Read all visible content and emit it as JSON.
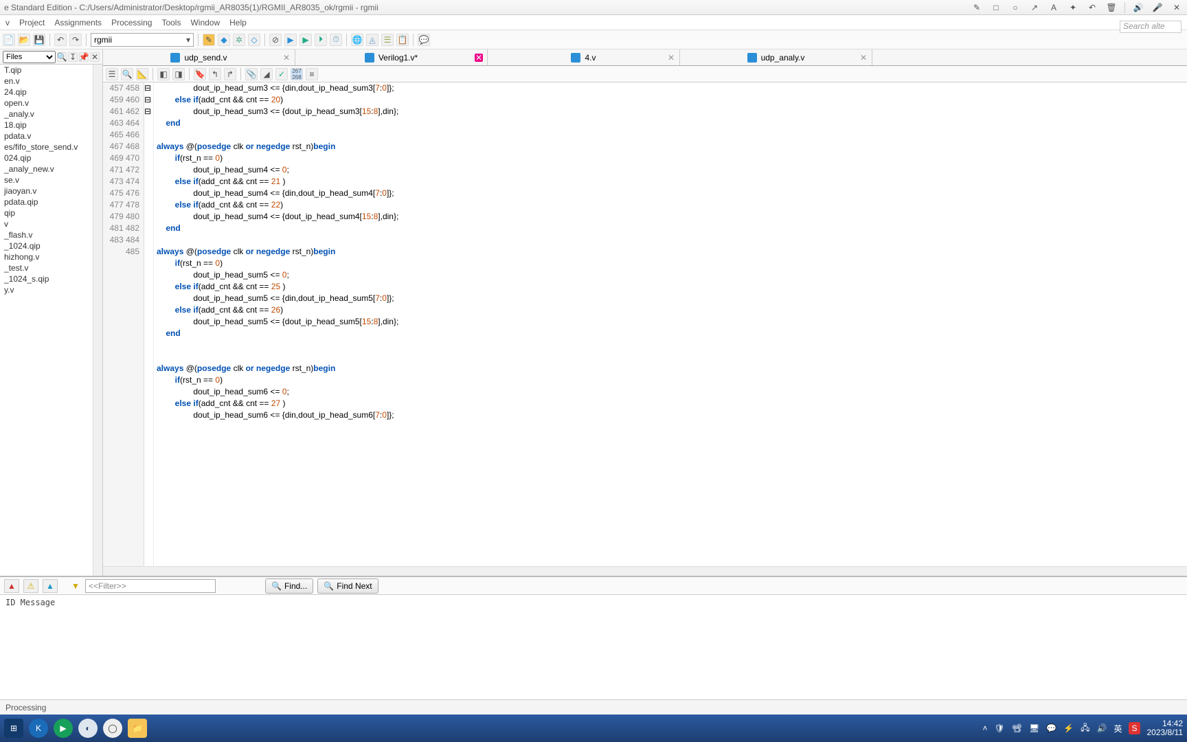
{
  "window": {
    "title": "e Standard Edition - C:/Users/Administrator/Desktop/rgmii_AR8035(1)/RGMII_AR8035_ok/rgmii - rgmii"
  },
  "menus": [
    "v",
    "Project",
    "Assignments",
    "Processing",
    "Tools",
    "Window",
    "Help"
  ],
  "search_placeholder": "Search alte",
  "combo_main": "rgmii",
  "sidebar": {
    "mode": "Files",
    "items": [
      "T.qip",
      "en.v",
      "24.qip",
      "open.v",
      "_analy.v",
      "18.qip",
      "pdata.v",
      "es/fifo_store_send.v",
      "024.qip",
      "_analy_new.v",
      "se.v",
      "jiaoyan.v",
      "pdata.qip",
      "qip",
      "v",
      "_flash.v",
      "_1024.qip",
      "hizhong.v",
      "_test.v",
      "_1024_s.qip",
      "y.v"
    ]
  },
  "tabs": [
    {
      "label": "udp_send.v",
      "active": false
    },
    {
      "label": "Verilog1.v*",
      "active": true
    },
    {
      "label": "4.v",
      "active": false
    },
    {
      "label": "udp_analy.v",
      "active": false
    }
  ],
  "code": {
    "first_line": 457,
    "lines": [
      {
        "n": 457,
        "ind": 16,
        "tokens": [
          [
            "id",
            "dout_ip_head_sum3 <= {din,dout_ip_head_sum3["
          ],
          [
            "num",
            "7"
          ],
          [
            "id",
            ":"
          ],
          [
            "num",
            "0"
          ],
          [
            "id",
            "]};"
          ]
        ]
      },
      {
        "n": 458,
        "ind": 8,
        "tokens": [
          [
            "kw",
            "else if"
          ],
          [
            "id",
            "(add_cnt && cnt == "
          ],
          [
            "num",
            "20"
          ],
          [
            "id",
            ")"
          ]
        ]
      },
      {
        "n": 459,
        "ind": 16,
        "tokens": [
          [
            "id",
            "dout_ip_head_sum3 <= {dout_ip_head_sum3["
          ],
          [
            "num",
            "15"
          ],
          [
            "id",
            ":"
          ],
          [
            "num",
            "8"
          ],
          [
            "id",
            "],din};"
          ]
        ]
      },
      {
        "n": 460,
        "ind": 4,
        "tokens": [
          [
            "kw",
            "end"
          ]
        ]
      },
      {
        "n": 461,
        "ind": 0,
        "tokens": []
      },
      {
        "n": 462,
        "ind": 0,
        "fold": true,
        "tokens": [
          [
            "kw",
            "always"
          ],
          [
            "id",
            " @("
          ],
          [
            "kw",
            "posedge"
          ],
          [
            "id",
            " clk "
          ],
          [
            "kw",
            "or"
          ],
          [
            "id",
            " "
          ],
          [
            "kw",
            "negedge"
          ],
          [
            "id",
            " rst_n)"
          ],
          [
            "kw",
            "begin"
          ]
        ]
      },
      {
        "n": 463,
        "ind": 8,
        "tokens": [
          [
            "kw",
            "if"
          ],
          [
            "id",
            "(rst_n == "
          ],
          [
            "num",
            "0"
          ],
          [
            "id",
            ")"
          ]
        ]
      },
      {
        "n": 464,
        "ind": 16,
        "tokens": [
          [
            "id",
            "dout_ip_head_sum4 <= "
          ],
          [
            "num",
            "0"
          ],
          [
            "id",
            ";"
          ]
        ]
      },
      {
        "n": 465,
        "ind": 8,
        "tokens": [
          [
            "kw",
            "else if"
          ],
          [
            "id",
            "(add_cnt && cnt == "
          ],
          [
            "num",
            "21"
          ],
          [
            "id",
            " )"
          ]
        ]
      },
      {
        "n": 466,
        "ind": 16,
        "tokens": [
          [
            "id",
            "dout_ip_head_sum4 <= {din,dout_ip_head_sum4["
          ],
          [
            "num",
            "7"
          ],
          [
            "id",
            ":"
          ],
          [
            "num",
            "0"
          ],
          [
            "id",
            "]};"
          ]
        ]
      },
      {
        "n": 467,
        "ind": 8,
        "tokens": [
          [
            "kw",
            "else if"
          ],
          [
            "id",
            "(add_cnt && cnt == "
          ],
          [
            "num",
            "22"
          ],
          [
            "id",
            ")"
          ]
        ]
      },
      {
        "n": 468,
        "ind": 16,
        "tokens": [
          [
            "id",
            "dout_ip_head_sum4 <= {dout_ip_head_sum4["
          ],
          [
            "num",
            "15"
          ],
          [
            "id",
            ":"
          ],
          [
            "num",
            "8"
          ],
          [
            "id",
            "],din};"
          ]
        ]
      },
      {
        "n": 469,
        "ind": 4,
        "tokens": [
          [
            "kw",
            "end"
          ]
        ]
      },
      {
        "n": 470,
        "ind": 0,
        "tokens": []
      },
      {
        "n": 471,
        "ind": 0,
        "fold": true,
        "tokens": [
          [
            "kw",
            "always"
          ],
          [
            "id",
            " @("
          ],
          [
            "kw",
            "posedge"
          ],
          [
            "id",
            " clk "
          ],
          [
            "kw",
            "or"
          ],
          [
            "id",
            " "
          ],
          [
            "kw",
            "negedge"
          ],
          [
            "id",
            " rst_n)"
          ],
          [
            "kw",
            "begin"
          ]
        ]
      },
      {
        "n": 472,
        "ind": 8,
        "tokens": [
          [
            "kw",
            "if"
          ],
          [
            "id",
            "(rst_n == "
          ],
          [
            "num",
            "0"
          ],
          [
            "id",
            ")"
          ]
        ]
      },
      {
        "n": 473,
        "ind": 16,
        "tokens": [
          [
            "id",
            "dout_ip_head_sum5 <= "
          ],
          [
            "num",
            "0"
          ],
          [
            "id",
            ";"
          ]
        ]
      },
      {
        "n": 474,
        "ind": 8,
        "tokens": [
          [
            "kw",
            "else if"
          ],
          [
            "id",
            "(add_cnt && cnt == "
          ],
          [
            "num",
            "25"
          ],
          [
            "id",
            " )"
          ]
        ]
      },
      {
        "n": 475,
        "ind": 16,
        "tokens": [
          [
            "id",
            "dout_ip_head_sum5 <= {din,dout_ip_head_sum5["
          ],
          [
            "num",
            "7"
          ],
          [
            "id",
            ":"
          ],
          [
            "num",
            "0"
          ],
          [
            "id",
            "]};"
          ]
        ]
      },
      {
        "n": 476,
        "ind": 8,
        "tokens": [
          [
            "kw",
            "else if"
          ],
          [
            "id",
            "(add_cnt && cnt == "
          ],
          [
            "num",
            "26"
          ],
          [
            "id",
            ")"
          ]
        ]
      },
      {
        "n": 477,
        "ind": 16,
        "tokens": [
          [
            "id",
            "dout_ip_head_sum5 <= {dout_ip_head_sum5["
          ],
          [
            "num",
            "15"
          ],
          [
            "id",
            ":"
          ],
          [
            "num",
            "8"
          ],
          [
            "id",
            "],din};"
          ]
        ]
      },
      {
        "n": 478,
        "ind": 4,
        "tokens": [
          [
            "kw",
            "end"
          ]
        ]
      },
      {
        "n": 479,
        "ind": 0,
        "tokens": []
      },
      {
        "n": 480,
        "ind": 0,
        "tokens": []
      },
      {
        "n": 481,
        "ind": 0,
        "fold": true,
        "tokens": [
          [
            "kw",
            "always"
          ],
          [
            "id",
            " @("
          ],
          [
            "kw",
            "posedge"
          ],
          [
            "id",
            " clk "
          ],
          [
            "kw",
            "or"
          ],
          [
            "id",
            " "
          ],
          [
            "kw",
            "negedge"
          ],
          [
            "id",
            " rst_n)"
          ],
          [
            "kw",
            "begin"
          ]
        ]
      },
      {
        "n": 482,
        "ind": 8,
        "tokens": [
          [
            "kw",
            "if"
          ],
          [
            "id",
            "(rst_n == "
          ],
          [
            "num",
            "0"
          ],
          [
            "id",
            ")"
          ]
        ]
      },
      {
        "n": 483,
        "ind": 16,
        "tokens": [
          [
            "id",
            "dout_ip_head_sum6 <= "
          ],
          [
            "num",
            "0"
          ],
          [
            "id",
            ";"
          ]
        ]
      },
      {
        "n": 484,
        "ind": 8,
        "tokens": [
          [
            "kw",
            "else if"
          ],
          [
            "id",
            "(add_cnt && cnt == "
          ],
          [
            "num",
            "27"
          ],
          [
            "id",
            " )"
          ]
        ]
      },
      {
        "n": 485,
        "ind": 16,
        "cut": true,
        "tokens": [
          [
            "id",
            "dout_ip_head_sum6 <= {din,dout_ip_head_sum6["
          ],
          [
            "num",
            "7"
          ],
          [
            "id",
            ":"
          ],
          [
            "num",
            "0"
          ],
          [
            "id",
            "]};"
          ]
        ]
      }
    ]
  },
  "bottom": {
    "filter_placeholder": "<<Filter>>",
    "find": "Find...",
    "find_next": "Find Next",
    "columns": "ID     Message"
  },
  "status": "Processing",
  "taskbar": {
    "time": "14:42",
    "date": "2023/8/11",
    "ime": "英"
  }
}
